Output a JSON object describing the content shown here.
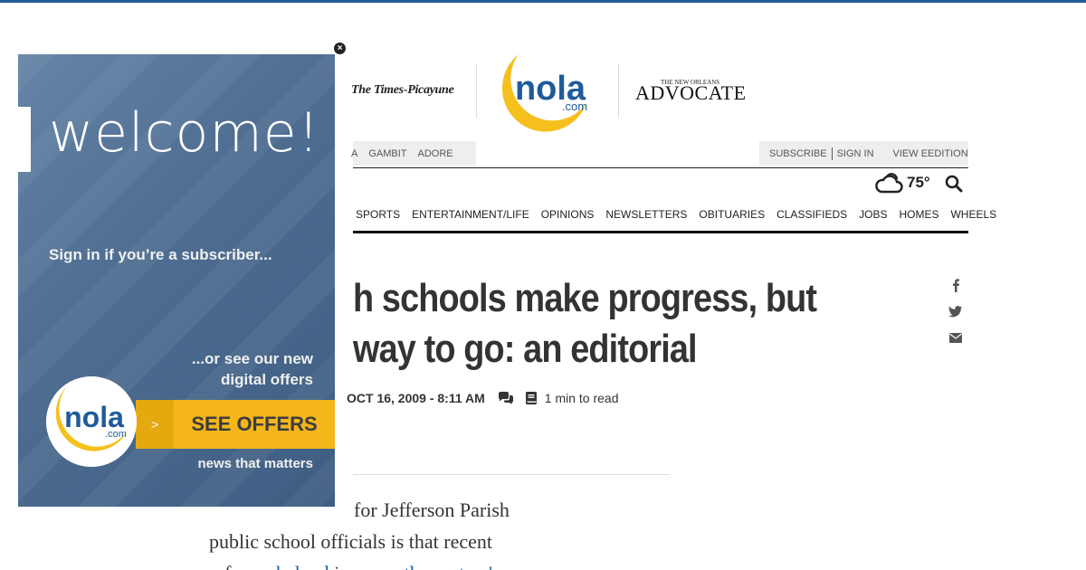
{
  "masthead": {
    "left_paper": "The Times-Picayune",
    "logo_text": "nola",
    "logo_sub": ".com",
    "right_paper_small": "THE NEW ORLEANS",
    "right_paper": "ADVOCATE"
  },
  "utility_nav": {
    "left_items": [
      "A",
      "GAMBIT",
      "ADORE"
    ],
    "subscribe": "SUBSCRIBE",
    "sign_in": "SIGN IN",
    "view_edition": "VIEW EEDITION"
  },
  "weather": {
    "icon": "cloud-icon",
    "temp": "75°"
  },
  "main_nav": [
    "SPORTS",
    "ENTERTAINMENT/LIFE",
    "OPINIONS",
    "NEWSLETTERS",
    "OBITUARIES",
    "CLASSIFIEDS",
    "JOBS",
    "HOMES",
    "WHEELS"
  ],
  "article": {
    "headline_line1": "h schools make progress, but",
    "headline_line2": "way to go: an editorial",
    "date": "OCT 16, 2009 - 8:11 AM",
    "read_time": "1 min to read",
    "body_line1": "for Jefferson Parish",
    "body_line2": "public school officials is that recent",
    "body_line3_prefix": "reforms ",
    "body_line3_link": "helped increase the system's"
  },
  "ad": {
    "welcome": "welcome!",
    "sign_in": "Sign in if you’re a subscriber...",
    "or_line1": "...or see our new",
    "or_line2": "digital offers",
    "arrow": ">",
    "cta": "SEE OFFERS",
    "logo_text": "nola",
    "logo_sub": ".com",
    "tagline": "news that matters",
    "close_glyph": "×"
  },
  "colors": {
    "brand_blue": "#1f5b9a",
    "nola_yellow": "#f5b61b",
    "ad_blue": "#4f6e92"
  }
}
